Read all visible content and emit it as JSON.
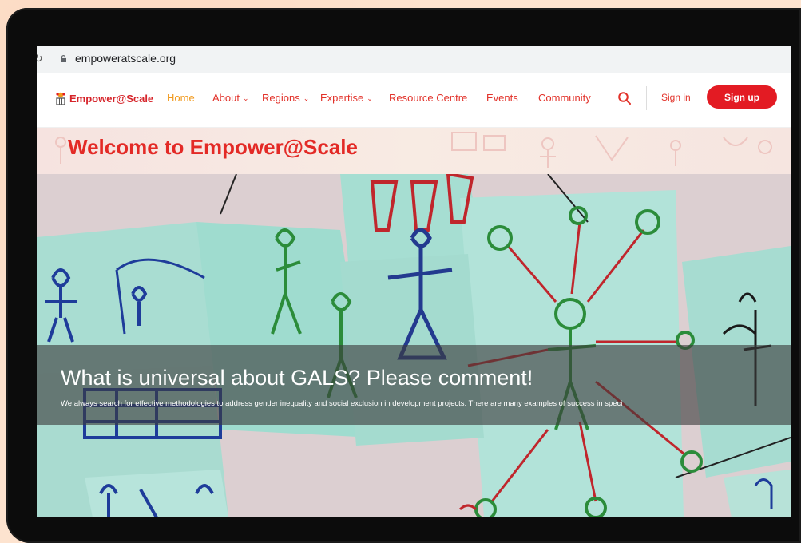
{
  "browser": {
    "url": "empoweratscale.org"
  },
  "site": {
    "logo_text": "Empower@Scale",
    "nav": [
      {
        "label": "Home",
        "dropdown": false,
        "active": true
      },
      {
        "label": "About",
        "dropdown": true,
        "active": false
      },
      {
        "label": "Regions",
        "dropdown": true,
        "active": false
      },
      {
        "label": "Expertise",
        "dropdown": true,
        "active": false
      },
      {
        "label": "Resource Centre",
        "dropdown": false,
        "active": false
      },
      {
        "label": "Events",
        "dropdown": false,
        "active": false
      },
      {
        "label": "Community",
        "dropdown": false,
        "active": false
      }
    ],
    "signin_label": "Sign in",
    "signup_label": "Sign up"
  },
  "welcome": {
    "title": "Welcome to Empower@Scale"
  },
  "hero": {
    "title": "What is universal about GALS? Please comment!",
    "text": "We always search for effective methodologies to address gender inequality and social exclusion in development projects. There are many examples of success in speci"
  },
  "colors": {
    "brand_red": "#e31b23",
    "nav_text": "#e2322a",
    "active_nav": "#f19a1e",
    "page_bg": "#fde3cf"
  },
  "icons": [
    "lock-icon",
    "search-icon",
    "logo-mark-icon",
    "chevron-down-icon",
    "reload-icon"
  ]
}
